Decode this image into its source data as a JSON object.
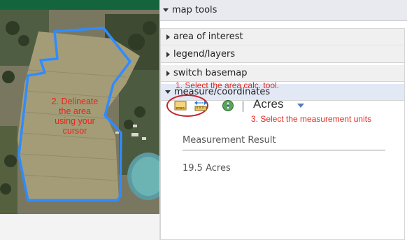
{
  "map": {
    "instruction_lines": [
      "2. Delineate",
      "the area",
      "using your",
      "cursor"
    ]
  },
  "panel": {
    "title": "map tools",
    "sections": [
      {
        "label": "area of interest",
        "expanded": false
      },
      {
        "label": "legend/layers",
        "expanded": false
      },
      {
        "label": "switch basemap",
        "expanded": false
      },
      {
        "label": "measure/coordinates",
        "expanded": true
      }
    ],
    "measure": {
      "step1_text": "1. Select the area calc. tool.",
      "step3_text": "3. Select the measurement units",
      "tools": [
        {
          "name": "area-tool-icon",
          "selected": true
        },
        {
          "name": "distance-tool-icon",
          "selected": false
        },
        {
          "name": "location-tool-icon",
          "selected": false
        }
      ],
      "separator": "|",
      "units": "Acres",
      "result_label": "Measurement Result",
      "result_value": "19.5 Acres"
    }
  },
  "colors": {
    "accent_red": "#e3291e",
    "polygon_blue": "#2f8cff",
    "header_green": "#14643e",
    "panel_header_bg": "#e8eaf0",
    "active_section_bg": "#e3e8f5"
  }
}
